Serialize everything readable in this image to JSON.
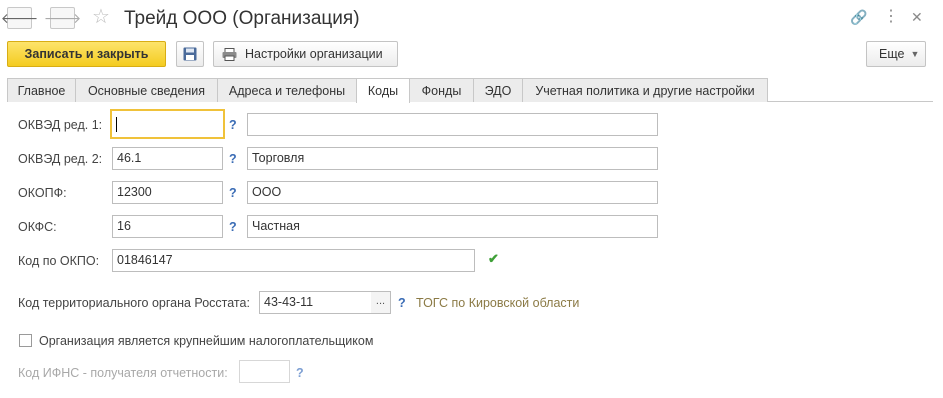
{
  "window": {
    "title": "Трейд ООО (Организация)",
    "icons": [
      "back-arrow-icon",
      "forward-arrow-icon",
      "star-icon",
      "link-icon",
      "more-vertical-icon",
      "close-icon"
    ]
  },
  "toolbar": {
    "save_close_label": "Записать и закрыть",
    "settings_label": "Настройки организации",
    "more_label": "Еще"
  },
  "tabs": [
    {
      "label": "Главное"
    },
    {
      "label": "Основные сведения"
    },
    {
      "label": "Адреса и телефоны"
    },
    {
      "label": "Коды",
      "active": true
    },
    {
      "label": "Фонды"
    },
    {
      "label": "ЭДО"
    },
    {
      "label": "Учетная политика и другие настройки"
    }
  ],
  "form": {
    "okved1": {
      "label": "ОКВЭД ред. 1:",
      "code": "",
      "description": ""
    },
    "okved2": {
      "label": "ОКВЭД ред. 2:",
      "code": "46.1",
      "description": "Торговля"
    },
    "okopf": {
      "label": "ОКОПФ:",
      "code": "12300",
      "description": "ООО"
    },
    "okfs": {
      "label": "ОКФС:",
      "code": "16",
      "description": "Частная"
    },
    "okpo": {
      "label": "Код по ОКПО:",
      "value": "01846147"
    },
    "rosstat": {
      "label": "Код территориального органа Росстата:",
      "value": "43-43-11",
      "description": "ТОГС по Кировской области",
      "pick_label": "..."
    },
    "largest_taxpayer": {
      "label": "Организация является крупнейшим налогоплательщиком",
      "checked": false
    },
    "ifns": {
      "label": "Код ИФНС - получателя отчетности:",
      "value": ""
    },
    "help_mark": "?"
  },
  "colors": {
    "primary_button": "#f4cc20",
    "help_link": "#3a6cb5",
    "focus_border": "#f0c23a",
    "valid_check": "#3fa038",
    "rosstat_desc": "#8b7a45"
  }
}
